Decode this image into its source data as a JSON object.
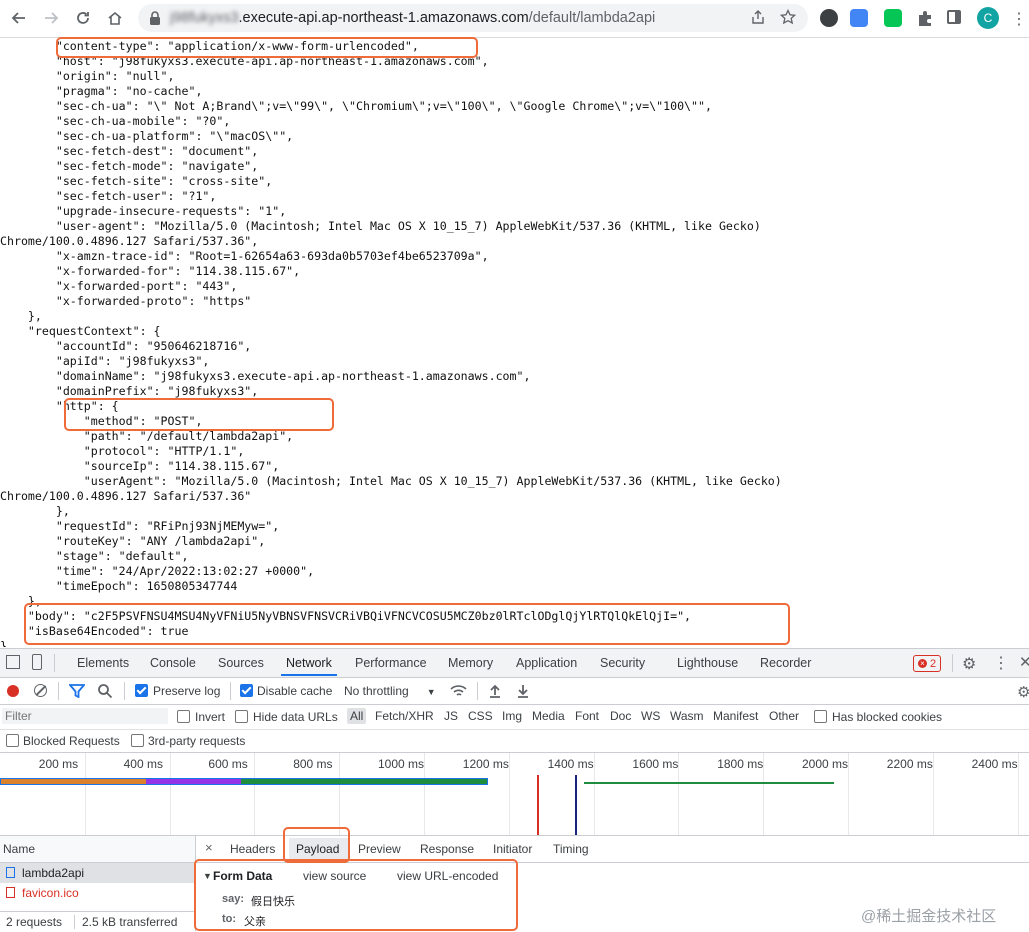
{
  "browser": {
    "url_prefix": "j98fukyxs3",
    "url_host": ".execute-api.ap-northeast-1.amazonaws.com",
    "url_path": "/default/lambda2api",
    "avatar_letter": "C"
  },
  "json_lines": [
    "        \"content-type\": \"application/x-www-form-urlencoded\",",
    "        \"host\": \"j98fukyxs3.execute-api.ap-northeast-1.amazonaws.com\",",
    "        \"origin\": \"null\",",
    "        \"pragma\": \"no-cache\",",
    "        \"sec-ch-ua\": \"\\\" Not A;Brand\\\";v=\\\"99\\\", \\\"Chromium\\\";v=\\\"100\\\", \\\"Google Chrome\\\";v=\\\"100\\\"\",",
    "        \"sec-ch-ua-mobile\": \"?0\",",
    "        \"sec-ch-ua-platform\": \"\\\"macOS\\\"\",",
    "        \"sec-fetch-dest\": \"document\",",
    "        \"sec-fetch-mode\": \"navigate\",",
    "        \"sec-fetch-site\": \"cross-site\",",
    "        \"sec-fetch-user\": \"?1\",",
    "        \"upgrade-insecure-requests\": \"1\",",
    "        \"user-agent\": \"Mozilla/5.0 (Macintosh; Intel Mac OS X 10_15_7) AppleWebKit/537.36 (KHTML, like Gecko)",
    "Chrome/100.0.4896.127 Safari/537.36\",",
    "        \"x-amzn-trace-id\": \"Root=1-62654a63-693da0b5703ef4be6523709a\",",
    "        \"x-forwarded-for\": \"114.38.115.67\",",
    "        \"x-forwarded-port\": \"443\",",
    "        \"x-forwarded-proto\": \"https\"",
    "    },",
    "    \"requestContext\": {",
    "        \"accountId\": \"950646218716\",",
    "        \"apiId\": \"j98fukyxs3\",",
    "        \"domainName\": \"j98fukyxs3.execute-api.ap-northeast-1.amazonaws.com\",",
    "        \"domainPrefix\": \"j98fukyxs3\",",
    "        \"http\": {",
    "            \"method\": \"POST\",",
    "            \"path\": \"/default/lambda2api\",",
    "            \"protocol\": \"HTTP/1.1\",",
    "            \"sourceIp\": \"114.38.115.67\",",
    "            \"userAgent\": \"Mozilla/5.0 (Macintosh; Intel Mac OS X 10_15_7) AppleWebKit/537.36 (KHTML, like Gecko)",
    "Chrome/100.0.4896.127 Safari/537.36\"",
    "        },",
    "        \"requestId\": \"RFiPnj93NjMEMyw=\",",
    "        \"routeKey\": \"ANY /lambda2api\",",
    "        \"stage\": \"default\",",
    "        \"time\": \"24/Apr/2022:13:02:27 +0000\",",
    "        \"timeEpoch\": 1650805347744",
    "    },",
    "    \"body\": \"c2F5PSVFNSU4MSU4NyVFNiU5NyVBNSVFNSVCRiVBQiVFNCVCOSU5MCZ0bz0lRTclODglQjYlRTQlQkElQjI=\",",
    "    \"isBase64Encoded\": true",
    "}"
  ],
  "devtools": {
    "tabs": [
      "Elements",
      "Console",
      "Sources",
      "Network",
      "Performance",
      "Memory",
      "Application",
      "Security",
      "Lighthouse",
      "Recorder"
    ],
    "active_tab": "Network",
    "error_count": "2",
    "preserve_log": "Preserve log",
    "disable_cache": "Disable cache",
    "throttling": "No throttling",
    "filter_placeholder": "Filter",
    "invert": "Invert",
    "hide_data_urls": "Hide data URLs",
    "type_filters": [
      "All",
      "Fetch/XHR",
      "JS",
      "CSS",
      "Img",
      "Media",
      "Font",
      "Doc",
      "WS",
      "Wasm",
      "Manifest",
      "Other"
    ],
    "has_blocked_cookies": "Has blocked cookies",
    "blocked_requests": "Blocked Requests",
    "third_party": "3rd-party requests",
    "timeline_ticks": [
      "200 ms",
      "400 ms",
      "600 ms",
      "800 ms",
      "1000 ms",
      "1200 ms",
      "1400 ms",
      "1600 ms",
      "1800 ms",
      "2000 ms",
      "2200 ms",
      "2400 ms"
    ],
    "name_header": "Name",
    "requests": [
      "lambda2api",
      "favicon.ico"
    ],
    "summary_requests": "2 requests",
    "summary_transferred": "2.5 kB transferred",
    "detail_tabs": [
      "Headers",
      "Payload",
      "Preview",
      "Response",
      "Initiator",
      "Timing"
    ],
    "active_detail_tab": "Payload",
    "form_data_title": "Form Data",
    "view_source": "view source",
    "view_url_encoded": "view URL-encoded",
    "form_fields": [
      {
        "key": "say:",
        "value": "假日快乐"
      },
      {
        "key": "to:",
        "value": "父亲"
      }
    ]
  },
  "watermark": "@稀土掘金技术社区",
  "colors": {
    "highlight": "#ef6b3a",
    "accent": "#1a73e8",
    "error": "#d93025"
  }
}
